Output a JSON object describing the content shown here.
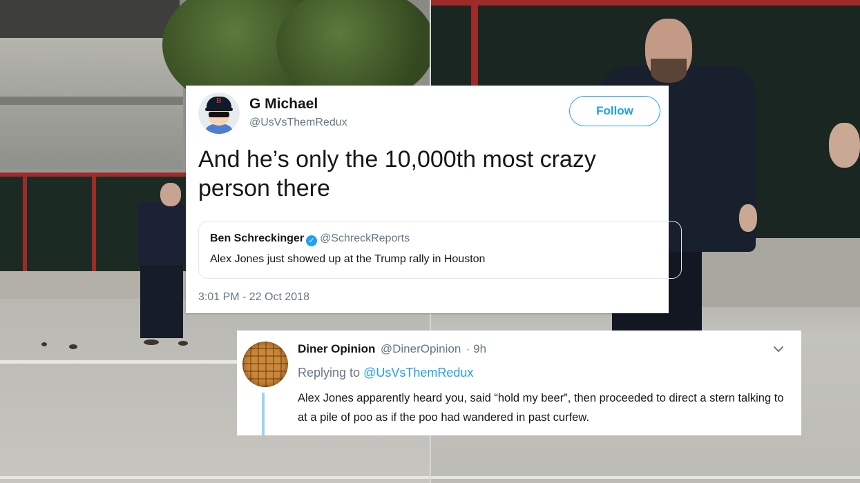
{
  "tweet": {
    "author_name": "G Michael",
    "author_handle": "@UsVsThemRedux",
    "follow_label": "Follow",
    "text": "And he’s only the 10,000th most crazy person there",
    "quoted": {
      "author_name": "Ben Schreckinger",
      "author_handle": "@SchreckReports",
      "text": "Alex Jones just showed up at the Trump rally in Houston"
    },
    "timestamp": "3:01 PM - 22 Oct 2018"
  },
  "reply": {
    "author_name": "Diner Opinion",
    "author_handle": "@DinerOpinion",
    "time": "· 9h",
    "replying_prefix": "Replying to",
    "replying_to": "@UsVsThemRedux",
    "text": "Alex Jones apparently heard you, said “hold my beer”, then proceeded to direct a stern talking to at a pile of poo as if the poo had wandered in past curfew."
  },
  "colors": {
    "twitter_blue": "#1da1f2",
    "text_primary": "#14171a",
    "text_secondary": "#657786"
  },
  "icons": [
    "verified-badge-icon",
    "chevron-down-icon"
  ]
}
